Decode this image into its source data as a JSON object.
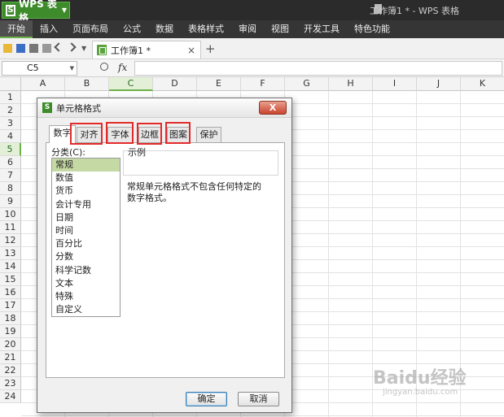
{
  "app": {
    "logo_label": "WPS 表格",
    "document_title": "工作簿1 * - WPS 表格"
  },
  "menu": [
    "开始",
    "插入",
    "页面布局",
    "公式",
    "数据",
    "表格样式",
    "审阅",
    "视图",
    "开发工具",
    "特色功能"
  ],
  "doc_tab": {
    "title": "工作簿1 *",
    "close": "×",
    "new": "+"
  },
  "formula_bar": {
    "cell_ref": "C5",
    "fx": "fx"
  },
  "columns": [
    "A",
    "B",
    "C",
    "D",
    "E",
    "F",
    "G",
    "H",
    "I",
    "J",
    "K"
  ],
  "rows": [
    "1",
    "2",
    "3",
    "4",
    "5",
    "6",
    "7",
    "8",
    "9",
    "10",
    "11",
    "12",
    "13",
    "14",
    "15",
    "16",
    "17",
    "18",
    "19",
    "20",
    "21",
    "22",
    "23",
    "24"
  ],
  "selected": {
    "column": "C",
    "row": "5"
  },
  "dialog": {
    "title": "单元格格式",
    "close_glyph": "X",
    "tabs": [
      "数字",
      "对齐",
      "字体",
      "边框",
      "图案",
      "保护"
    ],
    "active_tab": "数字",
    "highlighted_tabs": [
      "对齐",
      "字体",
      "边框",
      "图案"
    ],
    "category_label": "分类(C):",
    "categories": [
      "常规",
      "数值",
      "货币",
      "会计专用",
      "日期",
      "时间",
      "百分比",
      "分数",
      "科学记数",
      "文本",
      "特殊",
      "自定义"
    ],
    "selected_category": "常规",
    "sample_label": "示例",
    "description": "常规单元格格式不包含任何特定的数字格式。",
    "ok_label": "确定",
    "cancel_label": "取消"
  },
  "watermark": {
    "main": "Baidu经验",
    "sub": "jingyan.baidu.com"
  },
  "colors": {
    "accent": "#3d8b2a",
    "highlight": "#e32a2a",
    "selected_category": "#c5d9a4"
  }
}
